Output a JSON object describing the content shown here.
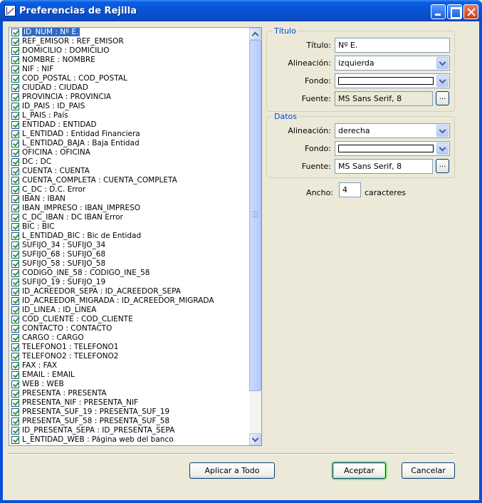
{
  "window": {
    "title": "Preferencias de Rejilla"
  },
  "columns": [
    "ID_NUM  :  Nº E.",
    "REF_EMISOR  :  REF_EMISOR",
    "DOMICILIO  :  DOMICILIO",
    "NOMBRE  :  NOMBRE",
    "NIF  :  NIF",
    "COD_POSTAL  :  COD_POSTAL",
    "CIUDAD  :  CIUDAD",
    "PROVINCIA  :  PROVINCIA",
    "ID_PAIS  :  ID_PAIS",
    "L_PAIS  :  País",
    "ENTIDAD  :  ENTIDAD",
    "L_ENTIDAD  :  Entidad Financiera",
    "L_ENTIDAD_BAJA  :  Baja Entidad",
    "OFICINA  :  OFICINA",
    "DC  :  DC",
    "CUENTA  :  CUENTA",
    "CUENTA_COMPLETA  :  CUENTA_COMPLETA",
    "C_DC  :  D.C. Error",
    "IBAN  :  IBAN",
    "IBAN_IMPRESO  :  IBAN_IMPRESO",
    "C_DC_IBAN  :  DC IBAN Error",
    "BIC  :  BIC",
    "L_ENTIDAD_BIC  :  Bic de Entidad",
    "SUFIJO_34  :  SUFIJO_34",
    "SUFIJO_68  :  SUFIJO_68",
    "SUFIJO_58  :  SUFIJO_58",
    "CODIGO_INE_58  :  CODIGO_INE_58",
    "SUFIJO_19  :  SUFIJO_19",
    "ID_ACREEDOR_SEPA  :  ID_ACREEDOR_SEPA",
    "ID_ACREEDOR_MIGRADA  :  ID_ACREEDOR_MIGRADA",
    "ID_LINEA  :  ID_LINEA",
    "COD_CLIENTE  :  COD_CLIENTE",
    "CONTACTO  :  CONTACTO",
    "CARGO  :  CARGO",
    "TELEFONO1  :  TELEFONO1",
    "TELEFONO2  :  TELEFONO2",
    "FAX  :  FAX",
    "EMAIL  :  EMAIL",
    "WEB  :  WEB",
    "PRESENTA  :  PRESENTA",
    "PRESENTA_NIF  :  PRESENTA_NIF",
    "PRESENTA_SUF_19  :  PRESENTA_SUF_19",
    "PRESENTA_SUF_58  :  PRESENTA_SUF_58",
    "ID_PRESENTA_SEPA  :  ID_PRESENTA_SEPA",
    "L_ENTIDAD_WEB  :  Página web del banco"
  ],
  "titulo_group": {
    "heading": "Título",
    "titulo_label": "Título:",
    "titulo_value": "Nº E.",
    "alineacion_label": "Alineación:",
    "alineacion_value": "izquierda",
    "fondo_label": "Fondo:",
    "fuente_label": "Fuente:",
    "fuente_value": "MS Sans Serif, 8",
    "ellipsis": "..."
  },
  "datos_group": {
    "heading": "Datos",
    "alineacion_label": "Alineación:",
    "alineacion_value": "derecha",
    "fondo_label": "Fondo:",
    "fuente_label": "Fuente:",
    "fuente_value": "MS Sans Serif, 8",
    "ellipsis": "..."
  },
  "ancho": {
    "label": "Ancho:",
    "value": "4",
    "unit": "caracteres"
  },
  "buttons": {
    "apply_all": "Aplicar a Todo",
    "accept": "Aceptar",
    "cancel": "Cancelar"
  },
  "colors": {
    "titlebar": "#0a5fe3",
    "selection": "#316ac5",
    "group_heading": "#0046d5",
    "default_button_glow": "#8ee87e"
  }
}
